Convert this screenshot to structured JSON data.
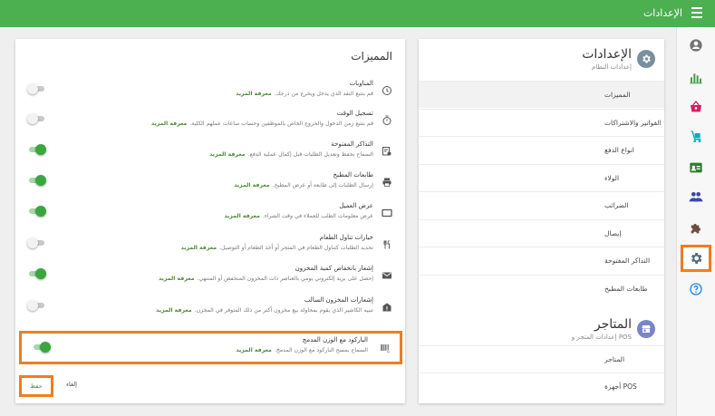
{
  "topbar": {
    "title": "الإعدادات"
  },
  "rail": {
    "items": [
      {
        "icon": "account-circle-icon",
        "color": "#757575"
      },
      {
        "icon": "bar-chart-icon",
        "color": "#43a047"
      },
      {
        "icon": "basket-icon",
        "color": "#d81b60"
      },
      {
        "icon": "trolley-icon",
        "color": "#00acc1"
      },
      {
        "icon": "id-card-icon",
        "color": "#2e7d32"
      },
      {
        "icon": "people-icon",
        "color": "#3949ab"
      },
      {
        "icon": "puzzle-icon",
        "color": "#6d4c41"
      },
      {
        "icon": "gear-icon",
        "color": "#546e7a",
        "active": true
      },
      {
        "icon": "help-icon",
        "color": "#1e88e5"
      }
    ]
  },
  "settings": {
    "title": "الإعدادات",
    "subtitle": "إعدادات النظام",
    "items": [
      {
        "label": "المميزات",
        "active": true
      },
      {
        "label": "الفواتير والاشتراكات"
      },
      {
        "label": "انواع الدفع"
      },
      {
        "label": "الولاء"
      },
      {
        "label": "الضرائب"
      },
      {
        "label": "إيصال"
      },
      {
        "label": "التذاكر المفتوحة"
      },
      {
        "label": "طابعات المطبخ"
      }
    ]
  },
  "stores": {
    "title": "المتاجر",
    "subtitle": "إعدادات المتجر و POS",
    "items": [
      {
        "label": "المتاجر"
      },
      {
        "label": "أجهزة POS"
      }
    ]
  },
  "features": {
    "title": "المميزات",
    "learn_more": "معرفة المزيد",
    "items": [
      {
        "icon": "clock-icon",
        "title": "المناوبات",
        "desc": "قم بتتبع النقد الذي يدخل ويخرج من درجك.",
        "on": false
      },
      {
        "icon": "timer-icon",
        "title": "تسجيل الوقت",
        "desc": "قم بتتبع زمن الدخول والخروج الخاص بالموظفين وحساب ساعات عملهم الكلية.",
        "on": false
      },
      {
        "icon": "open-ticket-icon",
        "title": "التذاكر المفتوحة",
        "desc": "السماح بحفظ وتعديل الطلبات قبل إكمال عملية الدفع.",
        "on": true
      },
      {
        "icon": "printer-icon",
        "title": "طابعات المطبخ",
        "desc": "إرسال الطلبات إلى طابعة أو عرض المطبخ.",
        "on": true
      },
      {
        "icon": "display-icon",
        "title": "عرض العميل",
        "desc": "عرض معلومات الطلب للعملاء في وقت الشراء.",
        "on": true
      },
      {
        "icon": "dining-icon",
        "title": "خيارات تناول الطعام",
        "desc": "تحديد الطلبات كتناول الطعام في المتجر أو أخذ الطعام أو التوصيل.",
        "on": false
      },
      {
        "icon": "mail-icon",
        "title": "إشعار بانخفاض كمية المخزون",
        "desc": "إحصل على بريد إلكتروني يومي بالعناصر ذات المخزون المنخفض أو المنتهي.",
        "on": true
      },
      {
        "icon": "stock-alert-icon",
        "title": "إشعارات المخزون السالب",
        "desc": "تنبيه الكاشير الذي يقوم بمحاولة بيع مخزون أكثر من ذلك المتوفر في المخزن.",
        "on": false
      },
      {
        "icon": "barcode-icon",
        "title": "الباركود مع الوزن المدمج",
        "desc": "السماح بمسح الباركود مع الوزن المدمج.",
        "on": true,
        "highlight": true
      }
    ],
    "save_label": "حفظ",
    "cancel_label": "إلغاء"
  }
}
